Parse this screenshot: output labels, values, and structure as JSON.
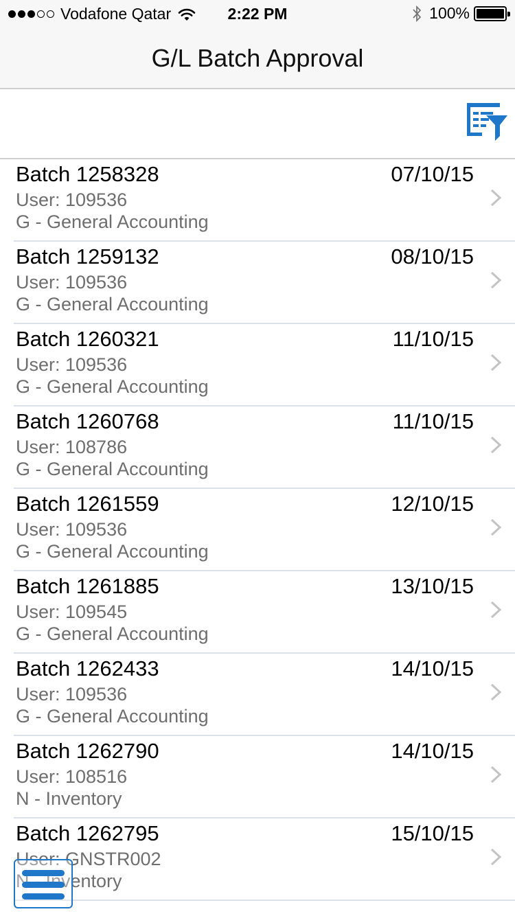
{
  "status_bar": {
    "carrier": "Vodafone Qatar",
    "time": "2:22 PM",
    "battery": "100%",
    "signal_bars_filled": 3,
    "signal_bars_total": 5
  },
  "header": {
    "title": "G/L Batch Approval"
  },
  "toolbar": {
    "filter_icon": "filter-list-icon",
    "accent_color": "#1e77c8"
  },
  "batches": [
    {
      "batch": "Batch 1258328",
      "date": "07/10/15",
      "user": "User: 109536",
      "ledger": "G - General Accounting"
    },
    {
      "batch": "Batch 1259132",
      "date": "08/10/15",
      "user": "User: 109536",
      "ledger": "G - General Accounting"
    },
    {
      "batch": "Batch 1260321",
      "date": "11/10/15",
      "user": "User: 109536",
      "ledger": "G - General Accounting"
    },
    {
      "batch": "Batch 1260768",
      "date": "11/10/15",
      "user": "User: 108786",
      "ledger": "G - General Accounting"
    },
    {
      "batch": "Batch 1261559",
      "date": "12/10/15",
      "user": "User: 109536",
      "ledger": "G - General Accounting"
    },
    {
      "batch": "Batch 1261885",
      "date": "13/10/15",
      "user": "User: 109545",
      "ledger": "G - General Accounting"
    },
    {
      "batch": "Batch 1262433",
      "date": "14/10/15",
      "user": "User: 109536",
      "ledger": "G - General Accounting"
    },
    {
      "batch": "Batch 1262790",
      "date": "14/10/15",
      "user": "User: 108516",
      "ledger": "N - Inventory"
    },
    {
      "batch": "Batch 1262795",
      "date": "15/10/15",
      "user": "User: GNSTR002",
      "ledger": "N - Inventory"
    }
  ],
  "menu": {
    "icon": "hamburger-menu-icon"
  }
}
